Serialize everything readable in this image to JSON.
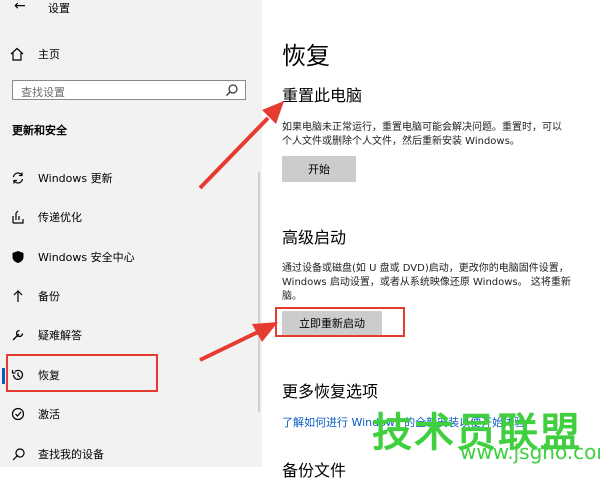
{
  "sidebar": {
    "back_glyph": "←",
    "title": "设置",
    "home_label": "主页",
    "search_placeholder": "查找设置",
    "section_heading": "更新和安全",
    "items": [
      {
        "label": "Windows 更新",
        "icon": "sync-icon"
      },
      {
        "label": "传递优化",
        "icon": "delivery-optimization-icon"
      },
      {
        "label": "Windows 安全中心",
        "icon": "shield-icon"
      },
      {
        "label": "备份",
        "icon": "backup-arrow-icon"
      },
      {
        "label": "疑难解答",
        "icon": "wrench-icon"
      },
      {
        "label": "恢复",
        "icon": "recovery-icon",
        "selected": true
      },
      {
        "label": "激活",
        "icon": "check-circle-icon"
      },
      {
        "label": "查找我的设备",
        "icon": "find-device-icon"
      }
    ]
  },
  "main": {
    "title": "恢复",
    "reset": {
      "heading": "重置此电脑",
      "line1": "如果电脑未正常运行，重置电脑可能会解决问题。重置时，可以",
      "line2": "个人文件或删除个人文件，然后重新安装 Windows。",
      "button": "开始"
    },
    "advanced": {
      "heading": "高级启动",
      "line1": "通过设备或磁盘(如 U 盘或 DVD)启动，更改你的电脑固件设置，",
      "line2": "Windows 启动设置，或者从系统映像还原 Windows。  这将重新",
      "line3": "脑。",
      "button": "立即重新启动"
    },
    "more": {
      "heading": "更多恢复选项",
      "link": "了解如何进行 Windows 的全新安装以便开始体验"
    },
    "cut_heading": "备份文件"
  },
  "watermark": {
    "text": "技术员联盟",
    "url": "www.jsgho.com"
  },
  "colors": {
    "sidebar_bg": "#f2f2f2",
    "accent": "#0a5dc2",
    "highlight": "#e53b30",
    "button_bg": "#cccccc",
    "watermark": "#3fcf3f"
  }
}
